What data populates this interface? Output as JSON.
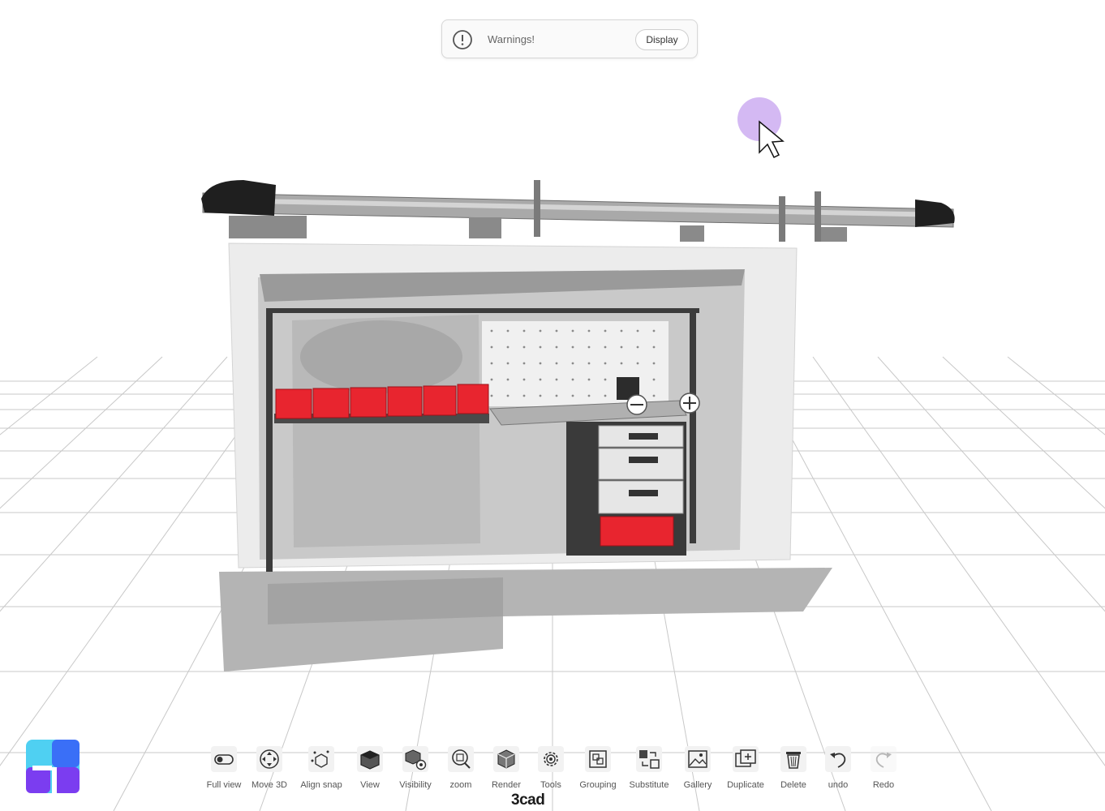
{
  "warning": {
    "text": "Warnings!",
    "button": "Display"
  },
  "toolbar": {
    "items": [
      {
        "label": "Full view",
        "icon": "toggle-icon",
        "enabled": true
      },
      {
        "label": "Move 3D",
        "icon": "move-3d-icon",
        "enabled": true
      },
      {
        "label": "Align snap",
        "icon": "align-snap-icon",
        "enabled": true
      },
      {
        "label": "View",
        "icon": "cube-view-icon",
        "enabled": true
      },
      {
        "label": "Visibility",
        "icon": "visibility-icon",
        "enabled": true
      },
      {
        "label": "zoom",
        "icon": "zoom-icon",
        "enabled": true
      },
      {
        "label": "Render",
        "icon": "render-icon",
        "enabled": true
      },
      {
        "label": "Tools",
        "icon": "gear-icon",
        "enabled": true
      },
      {
        "label": "Grouping",
        "icon": "grouping-icon",
        "enabled": true
      },
      {
        "label": "Substitute",
        "icon": "substitute-icon",
        "enabled": true
      },
      {
        "label": "Gallery",
        "icon": "gallery-icon",
        "enabled": true
      },
      {
        "label": "Duplicate",
        "icon": "duplicate-icon",
        "enabled": true
      },
      {
        "label": "Delete",
        "icon": "trash-icon",
        "enabled": true
      },
      {
        "label": "undo",
        "icon": "undo-icon",
        "enabled": true
      },
      {
        "label": "Redo",
        "icon": "redo-icon",
        "enabled": false
      }
    ]
  },
  "brand": {
    "name": "3cad",
    "logo_colors": [
      "#3a6ff7",
      "#7b3df0",
      "#4fd0f2"
    ]
  },
  "colors": {
    "accent_red": "#e8252f",
    "cursor_halo": "#c9a8f0",
    "grid": "#c8c8c8"
  }
}
